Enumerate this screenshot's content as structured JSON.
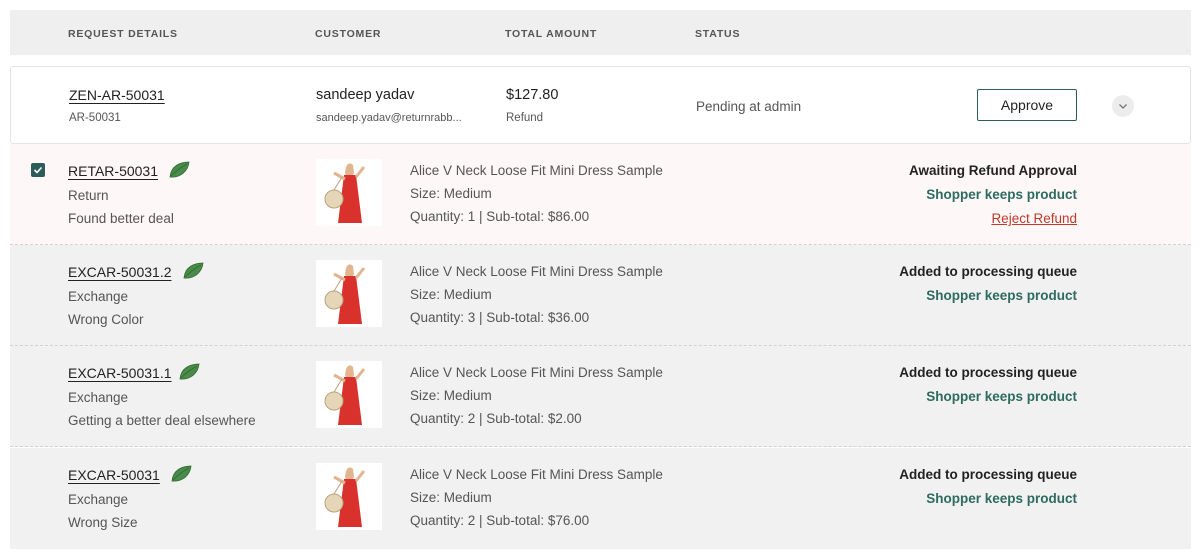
{
  "header": {
    "col_request": "REQUEST DETAILS",
    "col_customer": "CUSTOMER",
    "col_amount": "TOTAL AMOUNT",
    "col_status": "STATUS"
  },
  "summary": {
    "request_id": "ZEN-AR-50031",
    "request_sub": "AR-50031",
    "customer_name": "sandeep yadav",
    "customer_email": "sandeep.yadav@returnrabb...",
    "amount": "$127.80",
    "amount_type": "Refund",
    "status": "Pending at admin",
    "approve_label": "Approve"
  },
  "items": [
    {
      "id": "RETAR-50031",
      "type": "Return",
      "reason": "Found better deal",
      "product_name": "Alice V Neck Loose Fit Mini Dress Sample",
      "size": "Size: Medium",
      "qty": "Quantity: 1 | Sub-total: $86.00",
      "status": "Awaiting Refund Approval",
      "keeps": "Shopper keeps product",
      "reject": "Reject Refund"
    },
    {
      "id": "EXCAR-50031.2",
      "type": "Exchange",
      "reason": "Wrong Color",
      "product_name": "Alice V Neck Loose Fit Mini Dress Sample",
      "size": "Size: Medium",
      "qty": "Quantity: 3 | Sub-total: $36.00",
      "status": "Added to processing queue",
      "keeps": "Shopper keeps product"
    },
    {
      "id": "EXCAR-50031.1",
      "type": "Exchange",
      "reason": "Getting a better deal elsewhere",
      "product_name": "Alice V Neck Loose Fit Mini Dress Sample",
      "size": "Size: Medium",
      "qty": "Quantity: 2 | Sub-total: $2.00",
      "status": "Added to processing queue",
      "keeps": "Shopper keeps product"
    },
    {
      "id": "EXCAR-50031",
      "type": "Exchange",
      "reason": "Wrong Size",
      "product_name": "Alice V Neck Loose Fit Mini Dress Sample",
      "size": "Size: Medium",
      "qty": "Quantity: 2 | Sub-total: $76.00",
      "status": "Added to processing queue",
      "keeps": "Shopper keeps product"
    }
  ],
  "colors": {
    "accent": "#2d5d5a",
    "keeps_text": "#2d6a5f",
    "reject_text": "#c0392b",
    "leaf": "#4a8a4a",
    "dress": "#d9322c"
  }
}
